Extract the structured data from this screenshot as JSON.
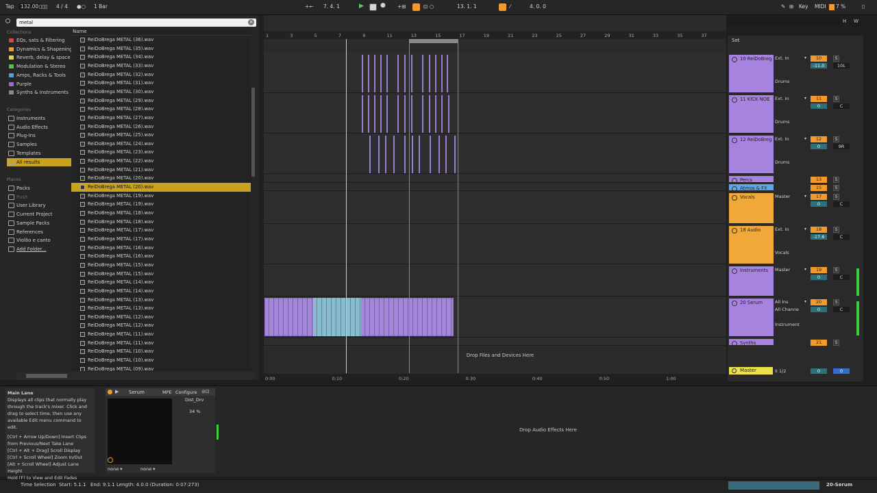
{
  "transport": {
    "tap": "Tap",
    "tempo": "132.00",
    "signature": "4 / 4",
    "quantize": "1 Bar",
    "position": "7.  4.  1",
    "loop_start": "13.  1.  1",
    "loop_length": "4.  0.  0",
    "key": "Key",
    "midi": "MIDI",
    "cpu": "7 %"
  },
  "browser": {
    "search_value": "metal",
    "collections_header": "Collections",
    "collections": [
      {
        "label": "EQs, sats & Filtering",
        "color": "#e0443a"
      },
      {
        "label": "Dynamics & Shapening",
        "color": "#f29a2e"
      },
      {
        "label": "Reverb, delay & space",
        "color": "#e9d64a"
      },
      {
        "label": "Modulation & Stereo",
        "color": "#5dbb4a"
      },
      {
        "label": "Amps, Racks & Tools",
        "color": "#45a6e0"
      },
      {
        "label": "Purple",
        "color": "#9b6ad6"
      },
      {
        "label": "Synths & Instruments",
        "color": "#8a8a8a"
      }
    ],
    "categories_header": "Categories",
    "categories": [
      "Instruments",
      "Audio Effects",
      "Plug-Ins",
      "Samples",
      "Templates",
      "All results"
    ],
    "places_header": "Places",
    "places": [
      "Packs",
      "Push",
      "User Library",
      "Current Project",
      "Sample Packs",
      "References",
      "Violão e canto",
      "Add Folder..."
    ],
    "name_header": "Name",
    "files": [
      "ReiDoBrega  METAL (36).wav",
      "ReiDoBrega  METAL (35).wav",
      "ReiDoBrega  METAL (34).wav",
      "ReiDoBrega  METAL (33).wav",
      "ReiDoBrega  METAL (32).wav",
      "ReiDoBrega  METAL (31).wav",
      "ReiDoBrega  METAL (30).wav",
      "ReiDoBrega  METAL (29).wav",
      "ReiDoBrega  METAL (28).wav",
      "ReiDoBrega  METAL (27).wav",
      "ReiDoBrega  METAL (26).wav",
      "ReiDoBrega  METAL (25).wav",
      "ReiDoBrega  METAL (24).wav",
      "ReiDoBrega  METAL (23).wav",
      "ReiDoBrega  METAL (22).wav",
      "ReiDoBrega  METAL (21).wav",
      "ReiDoBrega  METAL (20).wav",
      "ReiDoBrega  METAL (20).wav",
      "ReiDoBrega  METAL (19).wav",
      "ReiDoBrega  METAL (19).wav",
      "ReiDoBrega  METAL (18).wav",
      "ReiDoBrega  METAL (18).wav",
      "ReiDoBrega  METAL (17).wav",
      "ReiDoBrega  METAL (17).wav",
      "ReiDoBrega  METAL (16).wav",
      "ReiDoBrega  METAL (16).wav",
      "ReiDoBrega  METAL (15).wav",
      "ReiDoBrega  METAL (15).wav",
      "ReiDoBrega  METAL (14).wav",
      "ReiDoBrega  METAL (14).wav",
      "ReiDoBrega  METAL (13).wav",
      "ReiDoBrega  METAL (13).wav",
      "ReiDoBrega  METAL (12).wav",
      "ReiDoBrega  METAL (12).wav",
      "ReiDoBrega  METAL (11).wav",
      "ReiDoBrega  METAL (11).wav",
      "ReiDoBrega  METAL (10).wav",
      "ReiDoBrega  METAL (10).wav",
      "ReiDoBrega  METAL (09).wav"
    ],
    "selected_file_index": 17
  },
  "ruler": [
    "1",
    "3",
    "5",
    "7",
    "9",
    "11",
    "13",
    "15",
    "17",
    "19",
    "21",
    "23",
    "25",
    "27",
    "29",
    "31",
    "33",
    "35",
    "37"
  ],
  "time_axis": [
    "0:00",
    "0:10",
    "0:20",
    "0:30",
    "0:40",
    "0:50",
    "1:00"
  ],
  "arrangement": {
    "drop_files": "Drop Files and Devices Here",
    "set_label": "Set"
  },
  "tracks": [
    {
      "name": "10 ReiDoBreg",
      "color": "#a783e0",
      "number": "10",
      "input": "Ext. In",
      "group": "Drums",
      "vol": "-11.0",
      "pan": "10L"
    },
    {
      "name": "11 KICK NOE",
      "color": "#a783e0",
      "number": "11",
      "input": "Ext. In",
      "group": "Drums",
      "vol": "0",
      "pan": "C"
    },
    {
      "name": "12 ReiDoBreg",
      "color": "#a783e0",
      "number": "12",
      "input": "Ext. In",
      "group": "Drums",
      "vol": "0",
      "pan": "9R"
    },
    {
      "name": "Percs",
      "color": "#a783e0",
      "number": "13"
    },
    {
      "name": "Atmos & FX",
      "color": "#5ea7e8",
      "number": "15"
    },
    {
      "name": "Vocals",
      "color": "#f0a83a",
      "number": "17",
      "input": "Master",
      "vol": "0",
      "pan": "C"
    },
    {
      "name": "18 Audio",
      "color": "#f0a83a",
      "number": "18",
      "input": "Ext. In",
      "group": "Vocals",
      "vol": "-17.6",
      "pan": "C"
    },
    {
      "name": "Instruments",
      "color": "#a783e0",
      "number": "19",
      "input": "Master",
      "vol": "0",
      "pan": "C"
    },
    {
      "name": "20 Serum",
      "color": "#a783e0",
      "number": "20",
      "input": "All Ins",
      "channel": "All Channe",
      "group": "Instrument",
      "vol": "0",
      "pan": "C"
    },
    {
      "name": "Synths",
      "color": "#a783e0",
      "number": "21"
    }
  ],
  "master": {
    "name": "Master",
    "routing": "1/2",
    "vol": "0",
    "pan": "0"
  },
  "info": {
    "title": "Main Lane",
    "body": "Displays all clips that normally play through the track's mixer. Click and drag to select time, then use any available Edit menu command to edit.",
    "hint1": "[Ctrl + Arrow Up/Down] Insert Clips from Previous/Next Take Lane",
    "hint2": "[Ctrl + Alt + Drag] Scroll Display",
    "hint3": "[Ctrl + Scroll Wheel] Zoom In/Out",
    "hint4": "[Alt + Scroll Wheel] Adjust Lane Height",
    "hint5": "Hold [F] to View and Edit Fades"
  },
  "device": {
    "name": "Serum",
    "mpe": "MPE",
    "configure": "Configure",
    "param_name": "Dist_Drv",
    "param_value": "34 %",
    "sel1": "none",
    "sel2": "none"
  },
  "detail": {
    "drop_fx": "Drop Audio Effects Here"
  },
  "status": {
    "mode": "Time Selection",
    "start": "Start: 5.1.1",
    "end": "End: 9.1.1",
    "length": "Length: 4.0.0 (Duration: 0:07:273)",
    "track": "20-Serum"
  }
}
